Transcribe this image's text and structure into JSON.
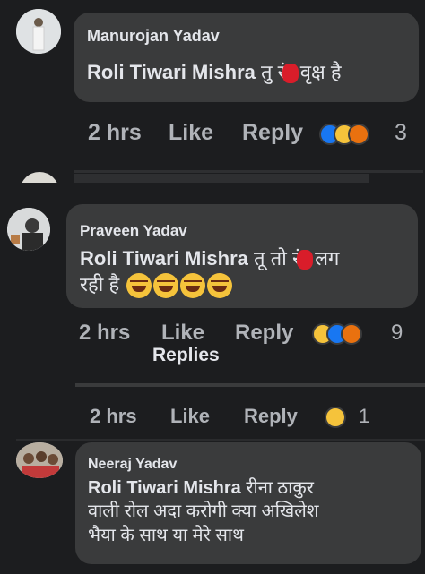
{
  "comments": [
    {
      "author": "Manurojan Yadav",
      "mention": "Roli Tiwari Mishra",
      "text_before": "तु रं",
      "text_after": " वृक्ष है",
      "time": "2 hrs",
      "like": "Like",
      "reply": "Reply",
      "reaction_count": "3"
    },
    {
      "author": "Praveen Yadav",
      "mention": "Roli Tiwari Mishra",
      "text_before": "तू तो रं",
      "text_after": " लग",
      "text_line2": "रही है",
      "time": "2 hrs",
      "like": "Like",
      "reply": "Reply",
      "reaction_count": "9",
      "replies_label": "Replies"
    },
    {
      "time": "2 hrs",
      "like": "Like",
      "reply": "Reply",
      "reaction_count": "1"
    },
    {
      "author": "Neeraj Yadav",
      "mention": "Roli Tiwari Mishra",
      "text": "रीना ठाकुर",
      "text_line2": "वाली रोल अदा करोगी क्या अखिलेश",
      "text_line3": "भैया के साथ या मेरे साथ"
    }
  ],
  "colors": {
    "background": "#1c1d1f",
    "bubble": "#3a3b3c",
    "text": "#e4e6eb",
    "meta": "#b0b3b8",
    "like_blue": "#1877f2",
    "haha_yellow": "#f5c33b",
    "angry_orange": "#e9710f",
    "redaction_red": "#d91d2a"
  },
  "icons": [
    "like-reaction-icon",
    "haha-reaction-icon",
    "angry-reaction-icon",
    "laughing-emoji-icon"
  ]
}
